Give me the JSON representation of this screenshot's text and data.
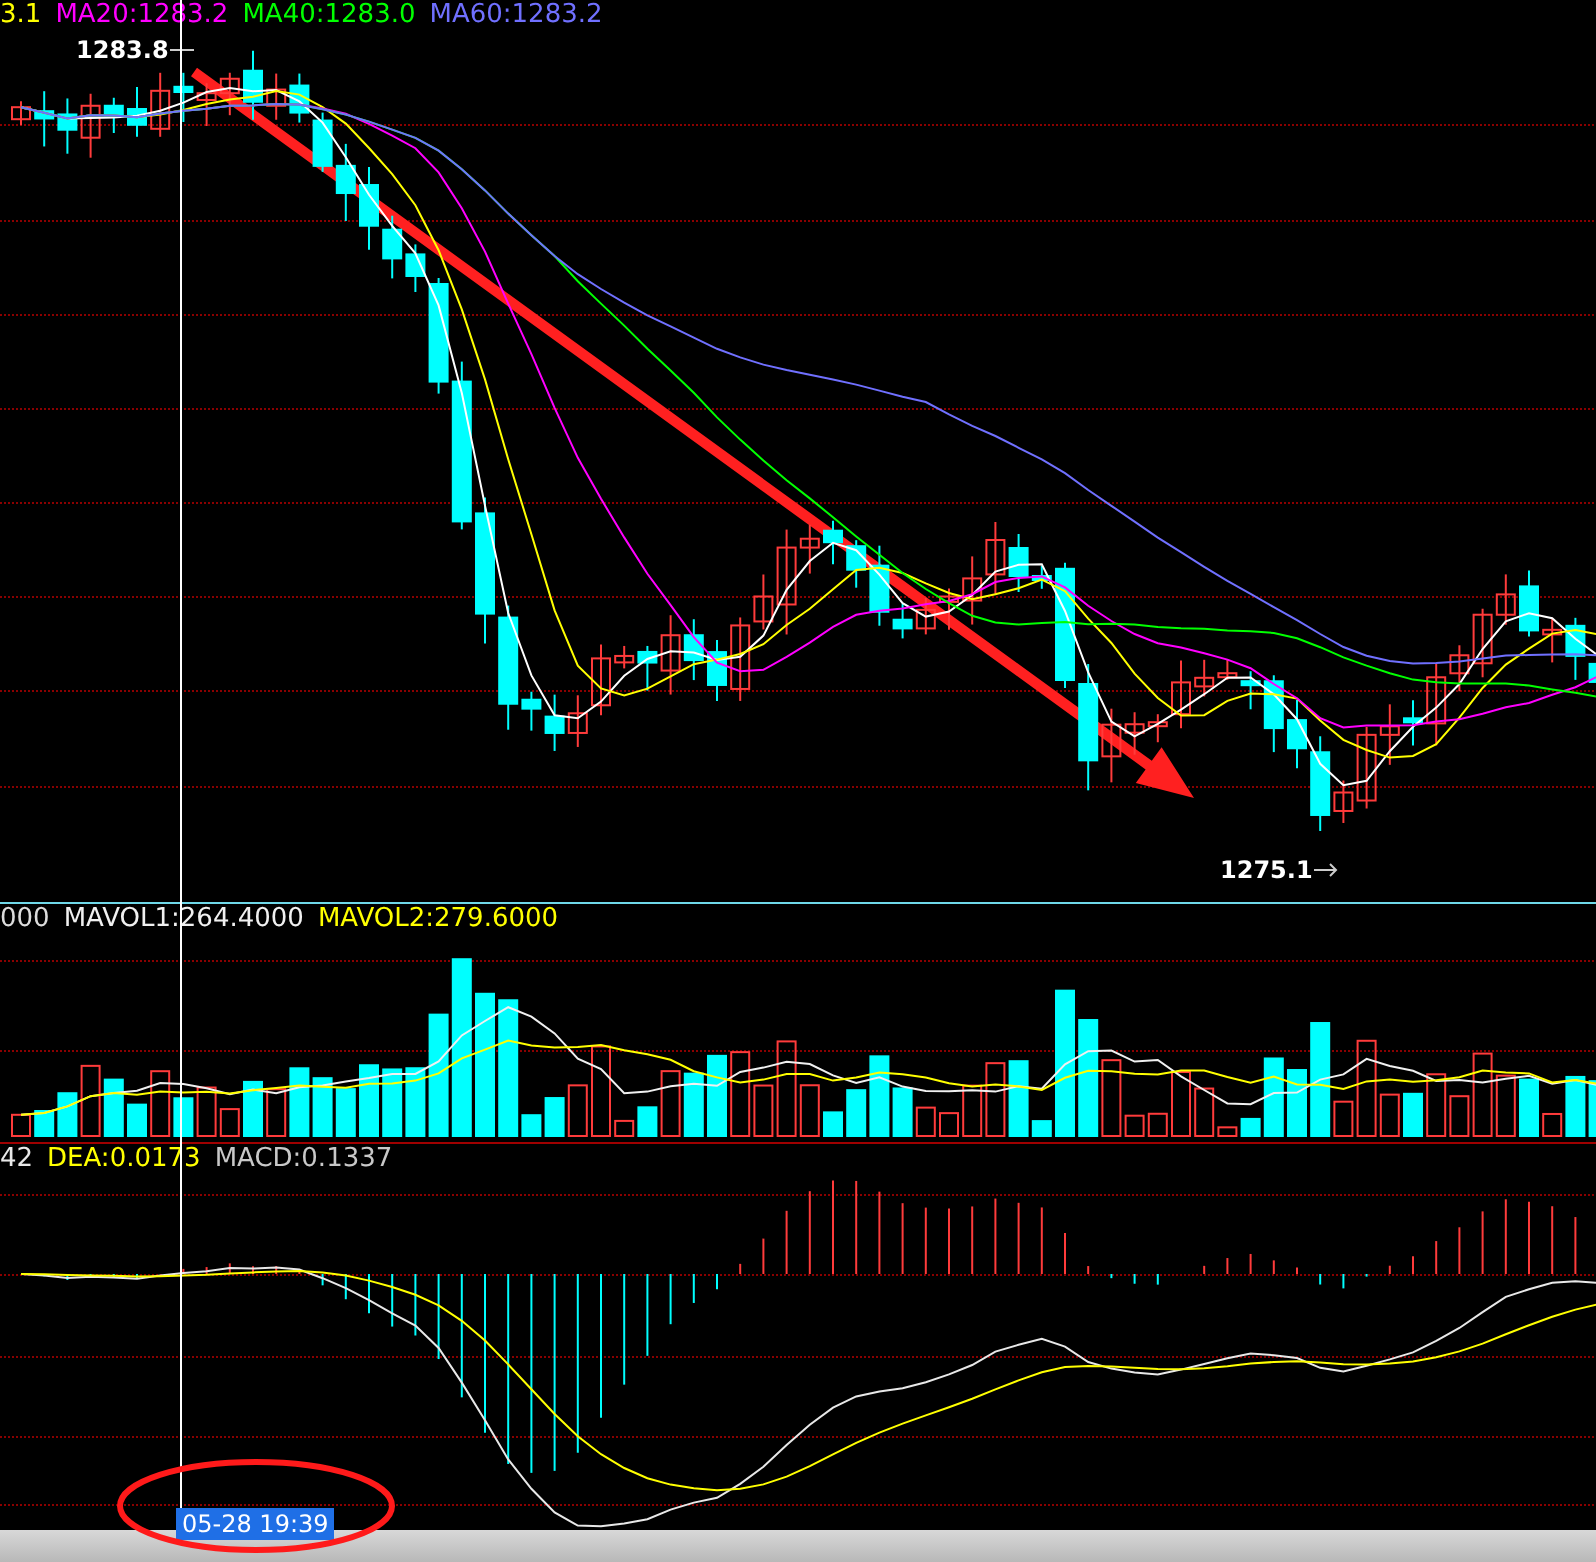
{
  "main_panel": {
    "legend": [
      {
        "text": "3.1",
        "color": "#ffff00"
      },
      {
        "text": "MA20:1283.2",
        "color": "#ff00ff"
      },
      {
        "text": "MA40:1283.0",
        "color": "#00ff00"
      },
      {
        "text": "MA60:1283.2",
        "color": "#7070ff"
      }
    ],
    "high_marker": "1283.8",
    "low_marker": "1275.1"
  },
  "volume_panel": {
    "legend": [
      {
        "text": "000",
        "color": "#dcdcdc"
      },
      {
        "text": "MAVOL1:264.4000",
        "color": "#f0f0f0"
      },
      {
        "text": "MAVOL2:279.6000",
        "color": "#ffff00"
      }
    ]
  },
  "macd_panel": {
    "legend": [
      {
        "text": "42",
        "color": "#e8e8e8"
      },
      {
        "text": "DEA:0.0173",
        "color": "#ffff00"
      },
      {
        "text": "MACD:0.1337",
        "color": "#c8c8c8"
      }
    ]
  },
  "crosshair": {
    "time_label": "05-28 19:39"
  }
}
